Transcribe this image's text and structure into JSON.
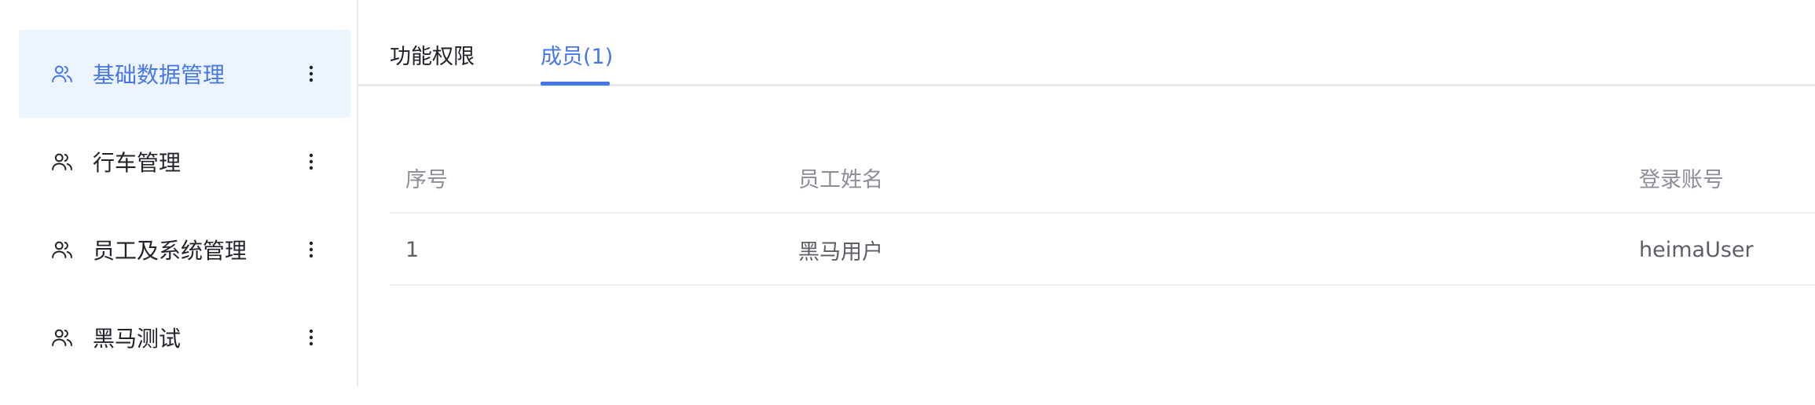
{
  "sidebar": {
    "items": [
      {
        "label": "基础数据管理",
        "active": true,
        "icon": "users-icon",
        "menu_icon": "more-vertical-icon"
      },
      {
        "label": "行车管理",
        "active": false,
        "icon": "users-icon",
        "menu_icon": "more-vertical-icon"
      },
      {
        "label": "员工及系统管理",
        "active": false,
        "icon": "users-icon",
        "menu_icon": "more-vertical-icon"
      },
      {
        "label": "黑马测试",
        "active": false,
        "icon": "users-icon",
        "menu_icon": "more-vertical-icon"
      }
    ]
  },
  "tabs": {
    "items": [
      {
        "label": "功能权限",
        "active": false
      },
      {
        "label": "成员(1)",
        "active": true
      }
    ]
  },
  "table": {
    "columns": [
      "序号",
      "员工姓名",
      "登录账号"
    ],
    "rows": [
      [
        "1",
        "黑马用户",
        "heimaUser"
      ]
    ]
  },
  "colors": {
    "accent": "#4677e8",
    "active_bg": "#ecf4ff",
    "text_primary": "#20232a",
    "text_header": "#8b8e96",
    "text_cell": "#5c5f66",
    "divider": "#e6e7ea"
  }
}
